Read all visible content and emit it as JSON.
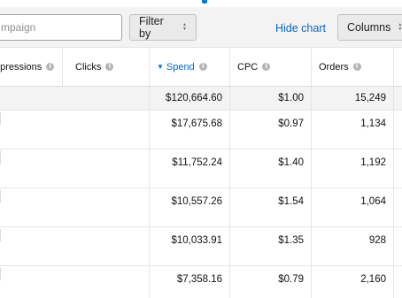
{
  "toolbar": {
    "search_placeholder": "mpaign",
    "filter_label": "Filter by",
    "hide_chart_label": "Hide chart",
    "columns_label": "Columns"
  },
  "table": {
    "headers": {
      "impressions": "npressions",
      "clicks": "Clicks",
      "spend": "Spend",
      "cpc": "CPC",
      "orders": "Orders"
    },
    "summary": {
      "spend": "$120,664.60",
      "cpc": "$1.00",
      "orders": "15,249"
    },
    "rows": [
      {
        "spend": "$17,675.68",
        "cpc": "$0.97",
        "orders": "1,134"
      },
      {
        "spend": "$11,752.24",
        "cpc": "$1.40",
        "orders": "1,192"
      },
      {
        "spend": "$10,557.26",
        "cpc": "$1.54",
        "orders": "1,064"
      },
      {
        "spend": "$10,033.91",
        "cpc": "$1.35",
        "orders": "928"
      },
      {
        "spend": "$7,358.16",
        "cpc": "$0.79",
        "orders": "2,160"
      }
    ]
  },
  "colors": {
    "accent": "#0a66c2",
    "toolbar_bg": "#f3f3f3",
    "summary_bg": "#f3f3f3"
  },
  "icons": {
    "info": "info-icon",
    "sort": "sort-descending-icon",
    "updown": "chevron-updown-icon"
  }
}
